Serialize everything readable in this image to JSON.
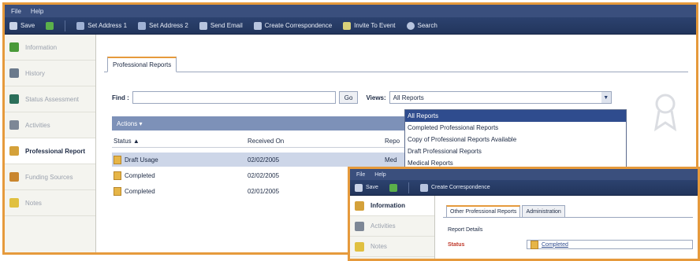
{
  "menu": [
    "File",
    "Help"
  ],
  "toolbar": {
    "items": [
      "Save",
      "Set Address 1",
      "Set Address 2",
      "Send Email",
      "Create Correspondence",
      "Invite To Event",
      "Search"
    ]
  },
  "sidebar": {
    "items": [
      {
        "label": "Information",
        "icon": "person-icon",
        "color": "#4a9a3a"
      },
      {
        "label": "History",
        "icon": "clipboard-icon",
        "color": "#6b7a8c"
      },
      {
        "label": "Status Assessment",
        "icon": "book-icon",
        "color": "#2c6f5a"
      },
      {
        "label": "Activities",
        "icon": "arrow-icon",
        "color": "#7d8796"
      },
      {
        "label": "Professional Report",
        "icon": "report-icon",
        "color": "#d4a13a"
      },
      {
        "label": "Funding Sources",
        "icon": "hand-icon",
        "color": "#c9862e"
      },
      {
        "label": "Notes",
        "icon": "note-icon",
        "color": "#e0c040"
      }
    ],
    "active_index": 4
  },
  "tab": {
    "label": "Professional Reports"
  },
  "find": {
    "label": "Find :",
    "value": "",
    "go_label": "Go"
  },
  "views": {
    "label": "Views:",
    "selected": "All Reports"
  },
  "dropdown": {
    "options": [
      "All Reports",
      "Completed Professional Reports",
      "Copy of Professional Reports Available",
      "Draft Professional Reports",
      "Medical Reports"
    ],
    "highlighted_index": 0
  },
  "actions": {
    "label": "Actions ▾"
  },
  "table": {
    "headers": [
      "Status ▲",
      "Received On",
      "Repo"
    ],
    "rows": [
      {
        "status": "Draft Usage",
        "received": "02/02/2005",
        "report": "Med",
        "selected": true
      },
      {
        "status": "Completed",
        "received": "02/02/2005",
        "report": "",
        "selected": false
      },
      {
        "status": "Completed",
        "received": "02/01/2005",
        "report": "",
        "selected": false
      }
    ]
  },
  "inset": {
    "menu": [
      "File",
      "Help"
    ],
    "toolbar": [
      "Save",
      "Create Correspondence"
    ],
    "sidebar": [
      "Information",
      "Activities",
      "Notes"
    ],
    "tabs": [
      "Other Professional Reports",
      "Administration"
    ],
    "section": "Report Details",
    "status_label": "Status",
    "status_value": "Completed"
  },
  "colors": {
    "accent": "#e69a3c",
    "toolbar": "#2c426f",
    "highlight": "#2f4c8e"
  }
}
